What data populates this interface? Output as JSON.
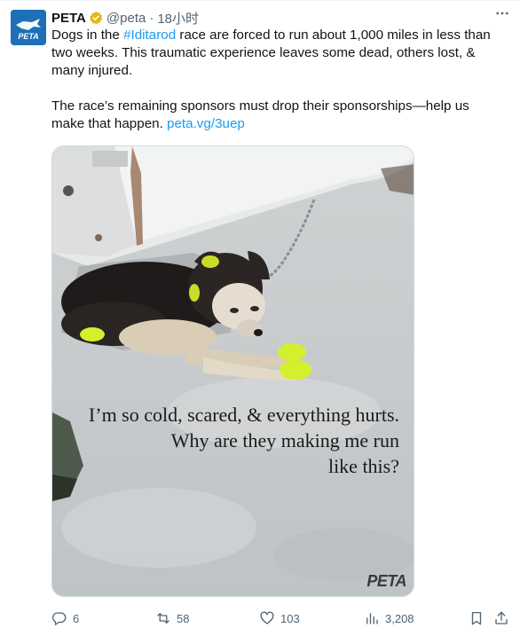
{
  "author": {
    "name": "PETA",
    "handle": "@peta",
    "separator": "·",
    "time": "18小时",
    "avatar_text": "PETA"
  },
  "tweet": {
    "line1_pre": "Dogs in the ",
    "hashtag": "#Iditarod",
    "line1_post": " race are forced to run about 1,000 miles in less than two weeks. This traumatic experience leaves some dead, others lost, & many injured.",
    "para2_text": "The race’s remaining sponsors must drop their sponsorships—help us make that happen. ",
    "link": "peta.vg/3uep"
  },
  "media": {
    "caption_line1": "I’m so cold, scared, & everything hurts.",
    "caption_line2": "Why are they making me run",
    "caption_line3": "like this?",
    "watermark": "PETA"
  },
  "actions": {
    "replies": "6",
    "reposts": "58",
    "likes": "103",
    "views": "3,208"
  },
  "colors": {
    "accent": "#1d9bf0",
    "secondary_text": "#536471",
    "avatar_bg": "#1d6fb8",
    "verified_gold": "#e2b719"
  },
  "icons": [
    "more-icon",
    "verified-badge-icon",
    "reply-icon",
    "repost-icon",
    "like-icon",
    "views-icon",
    "bookmark-icon",
    "share-icon"
  ]
}
